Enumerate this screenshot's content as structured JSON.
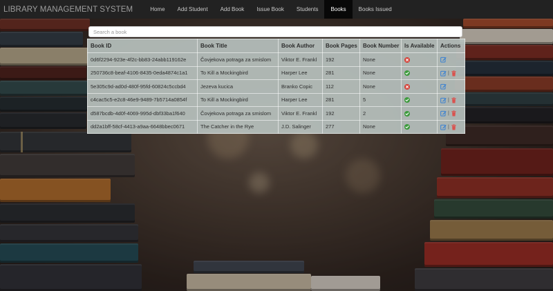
{
  "navbar": {
    "brand": "LIBRARY MANAGEMENT SYSTEM",
    "links": [
      "Home",
      "Add Student",
      "Add Book",
      "Issue Book",
      "Students",
      "Books",
      "Books Issued"
    ],
    "active": "Books"
  },
  "search": {
    "placeholder": "Search a book"
  },
  "table": {
    "headers": [
      "Book ID",
      "Book Title",
      "Book Author",
      "Book Pages",
      "Book Number",
      "Is Available",
      "Actions"
    ],
    "rows": [
      {
        "id": "0d6f2294-923e-4f2c-bb83-24abb119162e",
        "title": "Čovjekova potraga za smislom",
        "author": "Viktor E. Frankl",
        "pages": "192",
        "number": "None",
        "available": false,
        "deletable": false
      },
      {
        "id": "250736c8-beaf-4106-8435-0eda4874c1a1",
        "title": "To Kill a Mockingbird",
        "author": "Harper Lee",
        "pages": "281",
        "number": "None",
        "available": true,
        "deletable": true
      },
      {
        "id": "5e305c9d-ad0d-480f-95fd-60824c5ccbd4",
        "title": "Jezeva kucica",
        "author": "Branko Copic",
        "pages": "112",
        "number": "None",
        "available": false,
        "deletable": false
      },
      {
        "id": "c4cac5c5-e2c8-46e9-9489-7b5714a0854f",
        "title": "To Kill a Mockingbird",
        "author": "Harper Lee",
        "pages": "281",
        "number": "5",
        "available": true,
        "deletable": true
      },
      {
        "id": "d587bcdb-4d0f-4069-995d-dbf33ba1f640",
        "title": "Čovjekova potraga za smislom",
        "author": "Viktor E. Frankl",
        "pages": "192",
        "number": "2",
        "available": true,
        "deletable": true
      },
      {
        "id": "dd2a1bff-58cf-4413-a9aa-6648bbec0671",
        "title": "The Catcher in the Rye",
        "author": "J.D. Salinger",
        "pages": "277",
        "number": "None",
        "available": true,
        "deletable": true
      }
    ]
  },
  "icons": {
    "available": "check-circle-icon",
    "unavailable": "x-circle-icon",
    "edit": "edit-icon",
    "delete": "trash-icon"
  },
  "colors": {
    "navbar": "#222222",
    "available": "#3c9a3c",
    "unavailable": "#d43d34",
    "edit": "#2a7ad6",
    "delete": "#d9534f"
  }
}
